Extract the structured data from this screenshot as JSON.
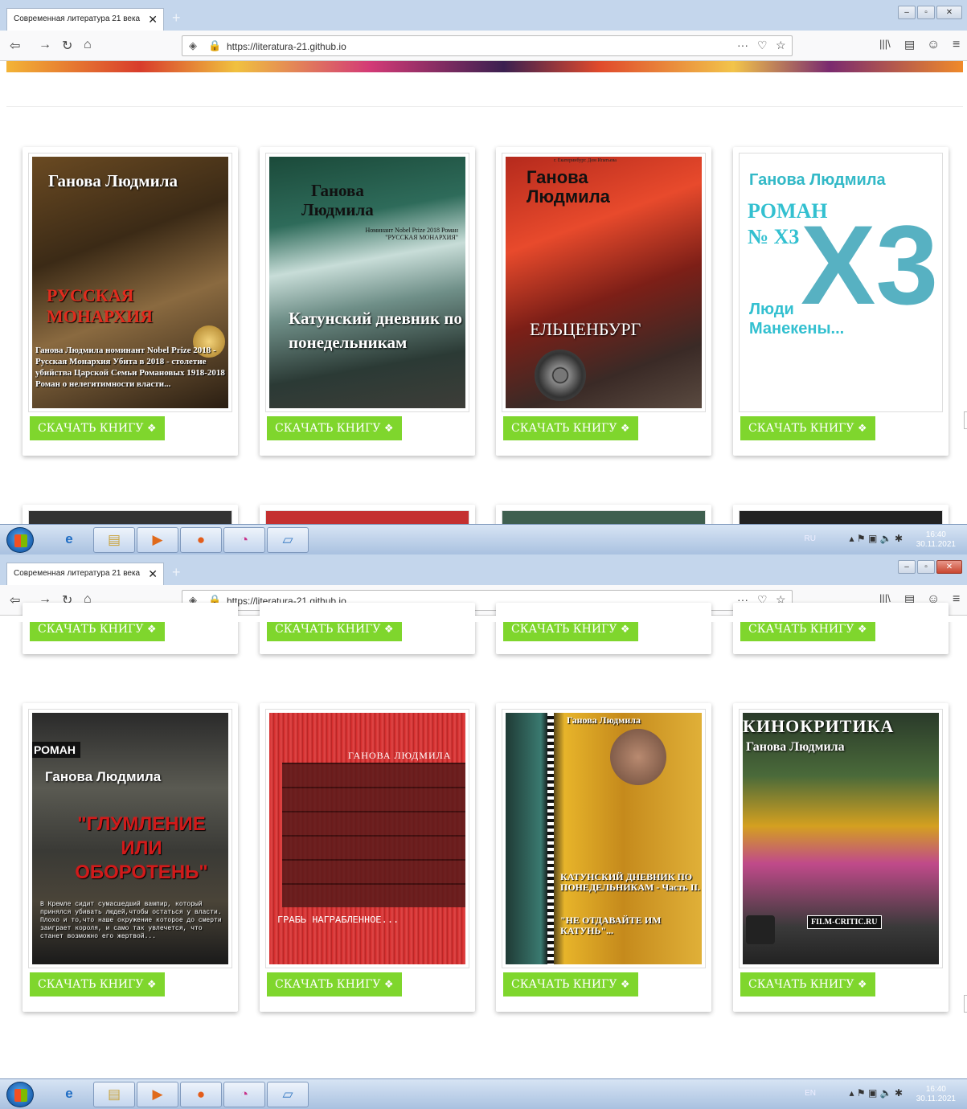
{
  "browser": {
    "tab_title": "Современная литература 21 века",
    "tab_close": "✕",
    "new_tab": "+",
    "url": "https://literatura-21.github.io",
    "page_actions": "···"
  },
  "books": [
    {
      "title_lines": [
        "Ганова Людмила"
      ],
      "subtitle": "РУССКАЯ МОНАРХИЯ",
      "blurb": "Ганова Людмила номинант Nobel Prize 2018 - Русская Монархия Убита в 2018 - столетие убийства Царской Семьи Романовых 1918-2018 Роман о нелегитимности власти...",
      "button": "СКАЧАТЬ КНИГУ"
    },
    {
      "title_lines": [
        "Ганова",
        "Людмила"
      ],
      "subtitle": "Катунский дневник по понедельникам",
      "blurb": "Номинант Nobel Prize 2018 Роман \"РУССКАЯ МОНАРХИЯ\"",
      "button": "СКАЧАТЬ КНИГУ"
    },
    {
      "title_lines": [
        "Ганова",
        "Людмила"
      ],
      "subtitle": "ЕЛЬЦЕНБУРГ",
      "blurb": "г. Екатеринбург. Дом Ипатьева",
      "button": "СКАЧАТЬ КНИГУ"
    },
    {
      "title_lines": [
        "Ганова Людмила"
      ],
      "subtitle": "РОМАН № X3",
      "blurb": "Люди Манекены...",
      "button": "СКАЧАТЬ КНИГУ"
    },
    {
      "title_lines": [
        "РОМАН",
        "Ганова Людмила"
      ],
      "subtitle": "\"ГЛУМЛЕНИЕ ИЛИ ОБОРОТЕНЬ\"",
      "blurb": "В Кремле сидит сумасшедший вампир, который принялся убивать людей,чтобы остаться у власти. Плохо и то,что наше окружение которое до смерти заиграет короля, и само так увлечется, что станет возможно его жертвой...",
      "button": "СКАЧАТЬ КНИГУ"
    },
    {
      "title_lines": [
        "ГАНОВА ЛЮДМИЛА"
      ],
      "subtitle": "ГРАБЬ НАГРАБЛЕННОЕ...",
      "blurb": "",
      "button": "СКАЧАТЬ КНИГУ"
    },
    {
      "title_lines": [
        "Ганова Людмила"
      ],
      "subtitle": "КАТУНСКИЙ ДНЕВНИК ПО ПОНЕДЕЛЬНИКАМ - Часть II.",
      "blurb": "\"НЕ ОТДАВАЙТЕ ИМ КАТУНЬ\"...",
      "button": "СКАЧАТЬ КНИГУ"
    },
    {
      "title_lines": [
        "КИНОКРИТИКА",
        "Ганова Людмила"
      ],
      "subtitle": "FILM-CRITIC.RU",
      "blurb": "",
      "button": "СКАЧАТЬ КНИГУ"
    }
  ],
  "taskbar": {
    "shot1": {
      "lang": "RU",
      "time": "16:40",
      "date": "30.11.2021"
    },
    "shot2": {
      "lang": "EN",
      "time": "16:40",
      "date": "30.11.2021"
    }
  },
  "colors": {
    "button": "#7fd62d",
    "tabbar": "#c4d6ec"
  }
}
